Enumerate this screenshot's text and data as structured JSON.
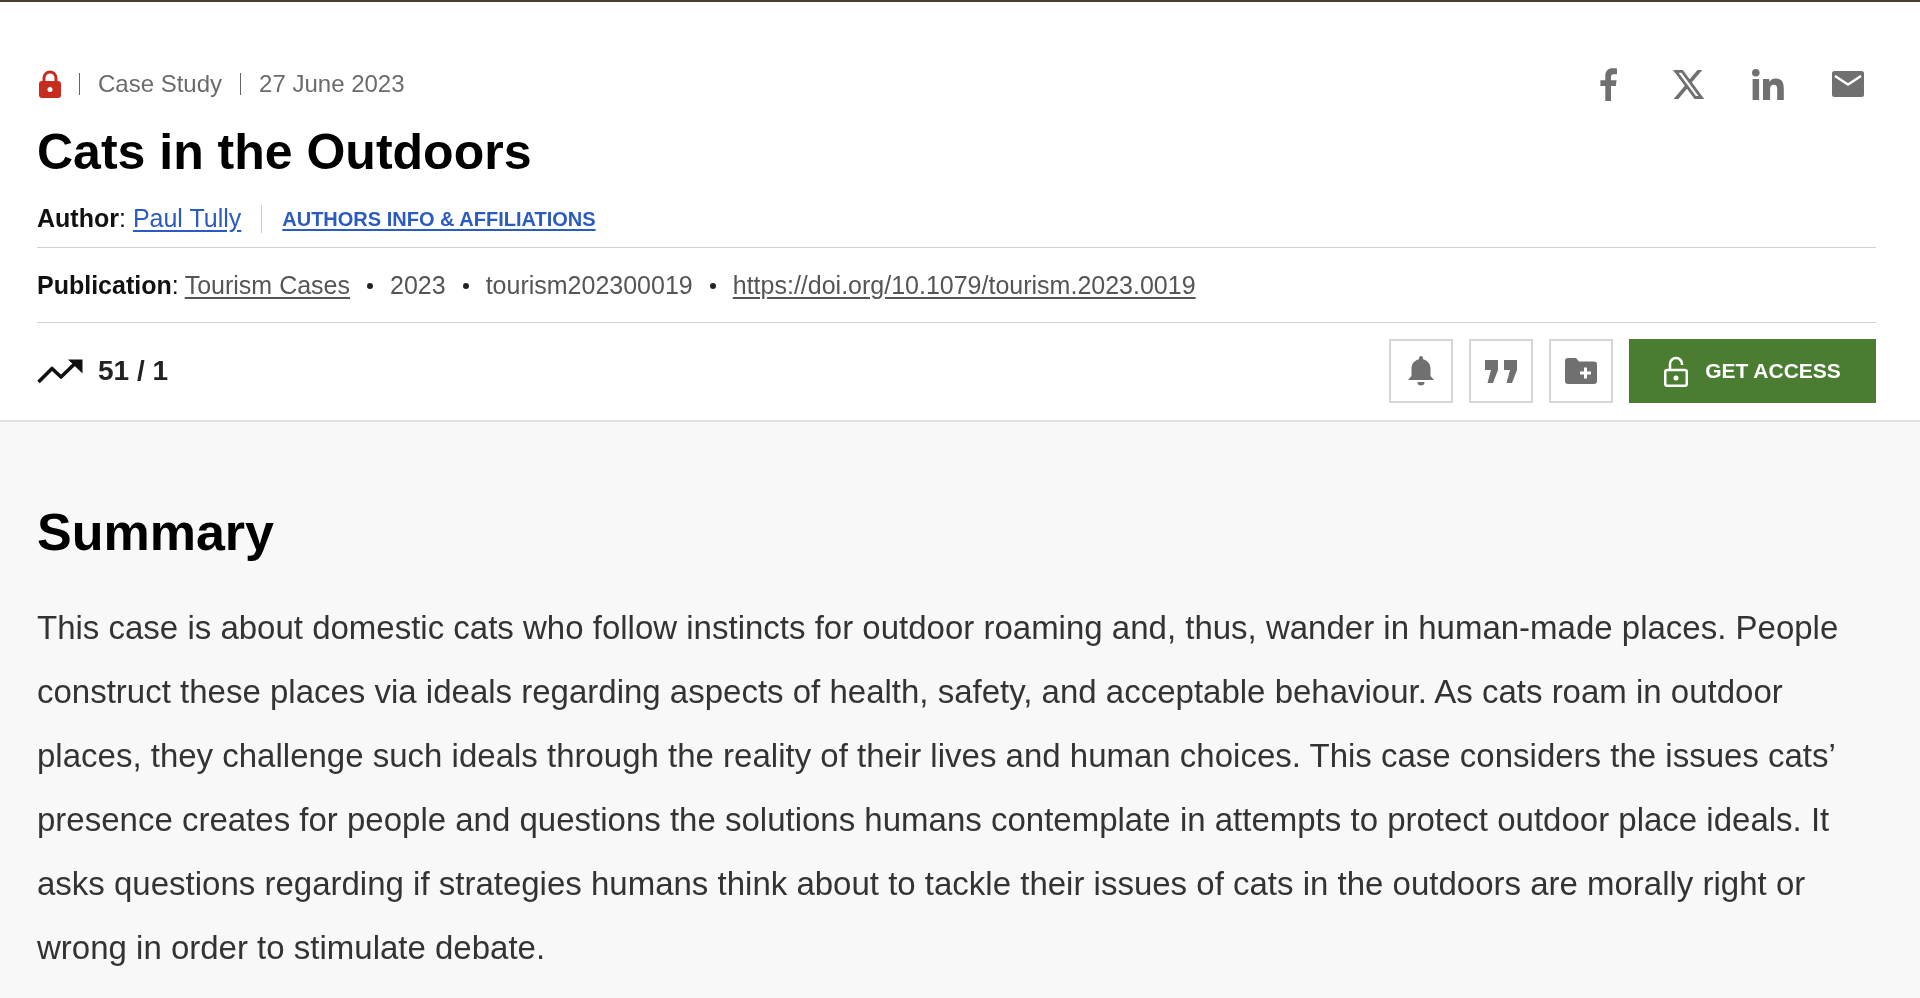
{
  "article_header": {
    "locked": true,
    "meta": [
      "Case Study",
      "27 June 2023"
    ],
    "title": "Cats in the Outdoors",
    "author": {
      "label": "**Author**:",
      "name": "Paul Tully",
      "info_link": "AUTHORS INFO & AFFILIATIONS"
    },
    "publication": {
      "label": "**Publication**:",
      "items": [
        {
          "kind": "journal",
          "text": "Tourism Cases"
        },
        {
          "kind": "year",
          "text": "2023"
        },
        {
          "kind": "id",
          "text": "tourism202300019"
        },
        {
          "kind": "doi",
          "text": "https://doi.org/10.1079/tourism.2023.0019"
        }
      ]
    },
    "metrics": "51 / 1",
    "get_access_button": "GET ACCESS"
  },
  "summary": {
    "heading": "Summary",
    "text": "This case is about domestic cats who follow instincts for outdoor roaming and, thus, wander in human-made places. People construct these places via ideals regarding aspects of health, safety, and acceptable behaviour. As cats roam in outdoor places, they challenge such ideals through the reality of their lives and human choices. This case considers the issues cats’ presence creates for people and questions the solutions humans contemplate in attempts to protect outdoor place ideals. It asks questions regarding if strategies humans think about to tackle their issues of cats in the outdoors are morally right or wrong in order to stimulate debate."
  }
}
